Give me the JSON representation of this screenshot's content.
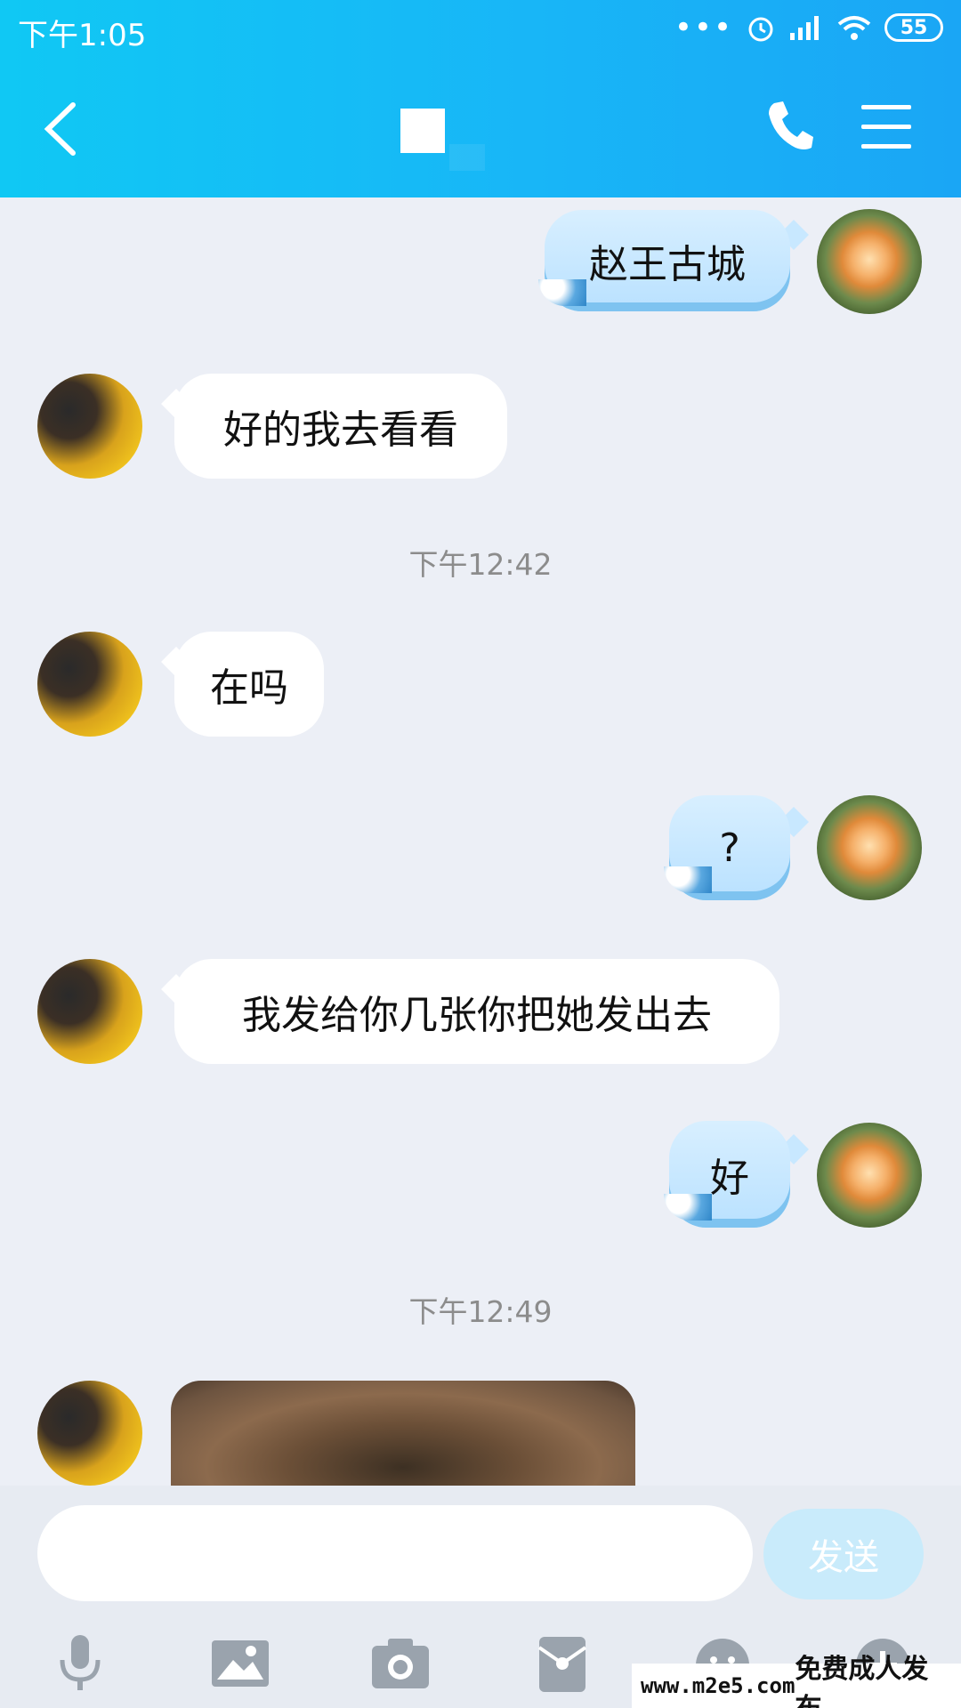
{
  "status_bar": {
    "time": "下午1:05",
    "dots": "•••",
    "battery": "55"
  },
  "header": {
    "back_icon": "chevron-left-icon",
    "call_icon": "phone-icon",
    "menu_icon": "menu-icon"
  },
  "messages": [
    {
      "side": "right",
      "text": "赵王古城"
    },
    {
      "side": "left",
      "text": "好的我去看看"
    },
    {
      "type": "timestamp",
      "text": "下午12:42"
    },
    {
      "side": "left",
      "text": "在吗"
    },
    {
      "side": "right",
      "text": "?"
    },
    {
      "side": "left",
      "text": "我发给你几张你把她发出去"
    },
    {
      "side": "right",
      "text": "好"
    },
    {
      "type": "timestamp",
      "text": "下午12:49"
    },
    {
      "side": "left",
      "type": "image"
    }
  ],
  "input": {
    "send_label": "发送"
  },
  "toolbar": [
    "microphone-icon",
    "image-icon",
    "camera-icon",
    "red-packet-icon",
    "emoji-icon",
    "plus-icon"
  ],
  "watermark": {
    "url": "www.m2e5.com",
    "text": "免费成人发布"
  },
  "colors": {
    "header": "#18b6f7",
    "background": "#eceff6",
    "send_button": "#c9ebfb"
  }
}
